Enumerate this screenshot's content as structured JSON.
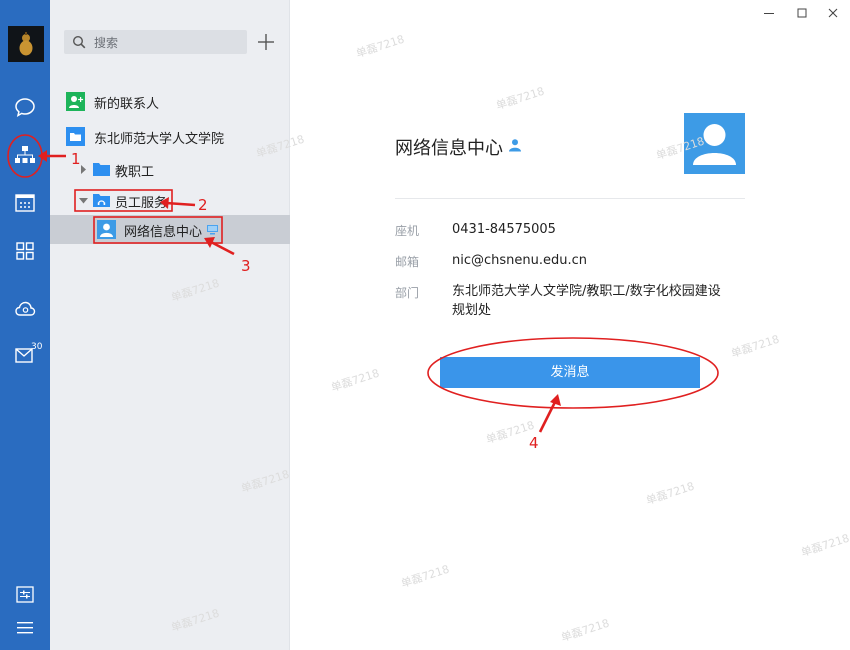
{
  "sidebar": {
    "mail_badge": "30"
  },
  "search": {
    "placeholder": "搜索"
  },
  "contacts": {
    "new_contacts": "新的联系人",
    "organization": "东北师范大学人文学院",
    "group_staff": "教职工",
    "group_service": "员工服务",
    "selected_contact": "网络信息中心"
  },
  "detail": {
    "name": "网络信息中心",
    "fields": [
      {
        "label": "座机",
        "value": "0431-84575005"
      },
      {
        "label": "邮箱",
        "value": "nic@chsnenu.edu.cn"
      },
      {
        "label": "部门",
        "value": "东北师范大学人文学院/教职工/数字化校园建设规划处"
      }
    ],
    "send_button": "发消息"
  },
  "annotations": [
    "1",
    "2",
    "3",
    "4"
  ],
  "watermark": "单磊7218",
  "colors": {
    "sidebar": "#2a6cc0",
    "accent": "#3a95ea",
    "annotation": "#e02020"
  }
}
